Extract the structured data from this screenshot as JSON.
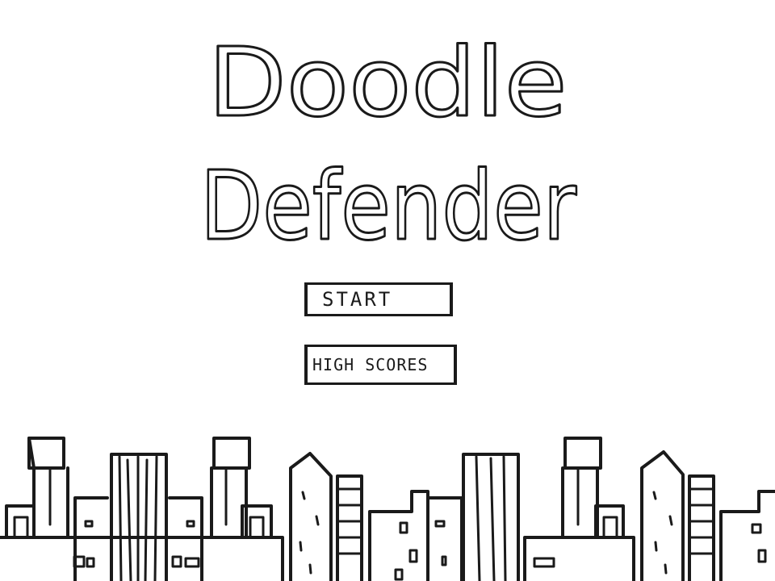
{
  "game": {
    "title_line1": "Doodle",
    "title_line2": "Defender"
  },
  "menu": {
    "start_label": "START",
    "high_scores_label": "HIGH SCORES"
  },
  "colors": {
    "background": "#ffffff",
    "ink": "#1a1a1a"
  }
}
